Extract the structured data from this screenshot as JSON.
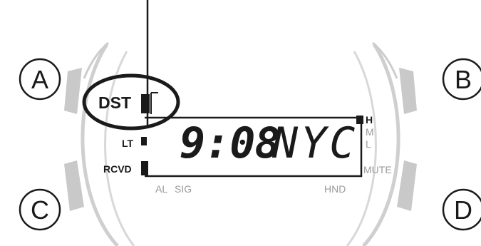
{
  "buttons": {
    "a": "A",
    "b": "B",
    "c": "C",
    "d": "D"
  },
  "indicators": {
    "dst": "DST",
    "lt": "LT",
    "rcvd": "RCVD",
    "al": "AL",
    "sig": "SIG",
    "hnd": "HND",
    "h": "H",
    "m": "M",
    "l": "L",
    "mute": "MUTE"
  },
  "display": {
    "time": "9:08",
    "city": "NYC"
  },
  "colors": {
    "ink": "#1a1a1a",
    "gray_text": "#9a9a9a",
    "bezel_light": "#d2d2d2",
    "bezel_dark": "#a9a9a9"
  }
}
